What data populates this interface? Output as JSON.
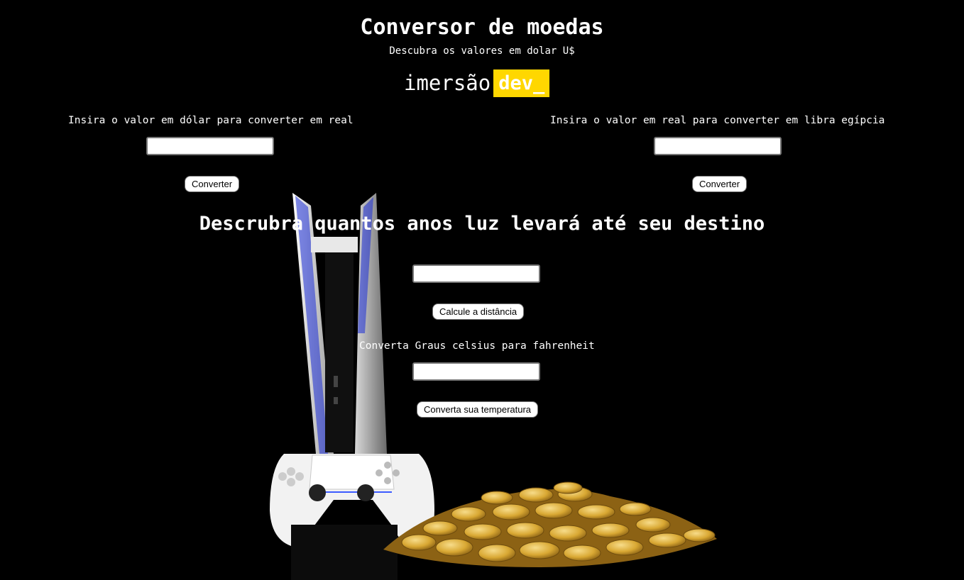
{
  "header": {
    "title": "Conversor de moedas",
    "subtitle": "Descubra os valores em dolar U$",
    "logo_word": "imersão",
    "logo_tag": "dev_"
  },
  "dollar_to_real": {
    "label": "Insira o valor em dólar para converter em real",
    "input_value": "",
    "button_label": "Converter"
  },
  "real_to_pound": {
    "label": "Insira o valor em real para converter em libra egípcia",
    "input_value": "",
    "button_label": "Converter"
  },
  "light_years": {
    "heading": "Descrubra quantos anos luz levará até seu destino",
    "input_value": "",
    "button_label": "Calcule a distância"
  },
  "temperature": {
    "label": "Converta Graus celsius para fahrenheit",
    "input_value": "",
    "button_label": "Converta sua temperatura"
  },
  "colors": {
    "background": "#000000",
    "logo_accent": "#ffd700",
    "text": "#ffffff"
  }
}
